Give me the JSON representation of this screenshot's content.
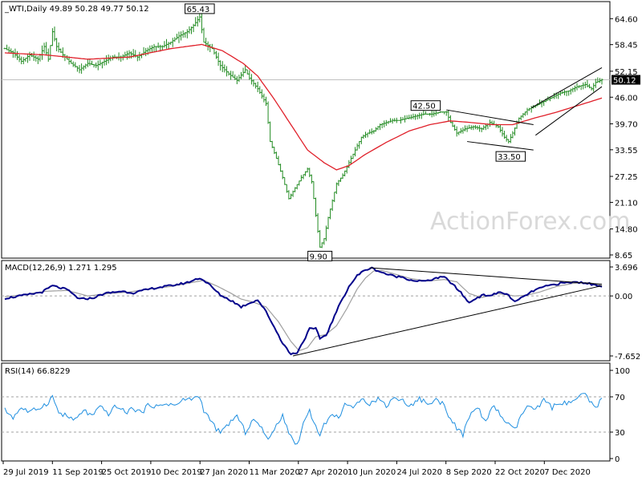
{
  "header": {
    "price_panel_label": "_WTI,Daily  49.89 50.28 49.77 50.12",
    "macd_panel_label": "MACD(12,26,9) 1.271 1.295",
    "rsi_panel_label": "RSI(14) 66.8229",
    "watermark": "ActionForex.com"
  },
  "chart_data": [
    {
      "type": "line",
      "panel": "price",
      "x_labels": [
        "29 Jul 2019",
        "11 Sep 2019",
        "25 Oct 2019",
        "10 Dec 2019",
        "27 Jan 2020",
        "11 Mar 2020",
        "27 Apr 2020",
        "10 Jun 2020",
        "24 Jul 2020",
        "8 Sep 2020",
        "22 Oct 2020",
        "7 Dec 2020"
      ],
      "y_ticks": [
        64.6,
        58.45,
        52.15,
        46.0,
        39.7,
        33.55,
        27.25,
        21.1,
        14.8,
        8.65
      ],
      "ylim": [
        8.65,
        67.5
      ],
      "last_price": 50.12,
      "last_price_label": "50.12",
      "price_anchors": [
        [
          0,
          57.5
        ],
        [
          4,
          56.5
        ],
        [
          8,
          54.5
        ],
        [
          12,
          56.0
        ],
        [
          16,
          55.0
        ],
        [
          19,
          58.0
        ],
        [
          21,
          55.0
        ],
        [
          23,
          61.5
        ],
        [
          25,
          58.0
        ],
        [
          28,
          56.0
        ],
        [
          32,
          54.0
        ],
        [
          36,
          52.5
        ],
        [
          40,
          54.0
        ],
        [
          44,
          53.5
        ],
        [
          48,
          54.5
        ],
        [
          52,
          55.5
        ],
        [
          56,
          55.5
        ],
        [
          60,
          56.5
        ],
        [
          64,
          55.5
        ],
        [
          68,
          57.0
        ],
        [
          72,
          58.0
        ],
        [
          76,
          58.0
        ],
        [
          80,
          59.0
        ],
        [
          84,
          60.5
        ],
        [
          88,
          61.5
        ],
        [
          91,
          63.0
        ],
        [
          94,
          65.0
        ],
        [
          96,
          59.0
        ],
        [
          100,
          57.5
        ],
        [
          104,
          53.5
        ],
        [
          108,
          51.5
        ],
        [
          112,
          50.0
        ],
        [
          116,
          52.5
        ],
        [
          118,
          50.5
        ],
        [
          122,
          48.0
        ],
        [
          126,
          44.5
        ],
        [
          128,
          35.5
        ],
        [
          131,
          31.5
        ],
        [
          134,
          27.0
        ],
        [
          137,
          22.0
        ],
        [
          140,
          24.5
        ],
        [
          143,
          27.0
        ],
        [
          146,
          29.0
        ],
        [
          148,
          26.0
        ],
        [
          150,
          18.0
        ],
        [
          152,
          10.5
        ],
        [
          154,
          12.5
        ],
        [
          156,
          17.5
        ],
        [
          158,
          21.5
        ],
        [
          160,
          25.5
        ],
        [
          163,
          27.5
        ],
        [
          166,
          30.5
        ],
        [
          169,
          33.5
        ],
        [
          172,
          36.5
        ],
        [
          175,
          37.5
        ],
        [
          178,
          38.0
        ],
        [
          181,
          39.5
        ],
        [
          184,
          40.0
        ],
        [
          187,
          40.5
        ],
        [
          190,
          40.5
        ],
        [
          194,
          41.0
        ],
        [
          198,
          41.5
        ],
        [
          202,
          42.0
        ],
        [
          206,
          42.0
        ],
        [
          210,
          42.5
        ],
        [
          213,
          42.5
        ],
        [
          215,
          40.0
        ],
        [
          218,
          37.5
        ],
        [
          222,
          38.5
        ],
        [
          226,
          39.0
        ],
        [
          230,
          38.5
        ],
        [
          234,
          40.0
        ],
        [
          238,
          39.0
        ],
        [
          241,
          36.5
        ],
        [
          243,
          35.5
        ],
        [
          245,
          37.5
        ],
        [
          248,
          41.0
        ],
        [
          252,
          43.0
        ],
        [
          256,
          44.0
        ],
        [
          260,
          45.0
        ],
        [
          264,
          46.0
        ],
        [
          268,
          47.0
        ],
        [
          272,
          47.5
        ],
        [
          276,
          48.5
        ],
        [
          280,
          49.0
        ],
        [
          283,
          48.0
        ],
        [
          285,
          49.5
        ],
        [
          288,
          50.12
        ]
      ],
      "ma55_anchors": [
        [
          0,
          56.5
        ],
        [
          20,
          56.0
        ],
        [
          40,
          55.0
        ],
        [
          60,
          55.5
        ],
        [
          80,
          57.5
        ],
        [
          95,
          58.5
        ],
        [
          105,
          57.0
        ],
        [
          115,
          54.0
        ],
        [
          122,
          51.0
        ],
        [
          130,
          45.5
        ],
        [
          138,
          39.5
        ],
        [
          146,
          33.5
        ],
        [
          154,
          30.5
        ],
        [
          160,
          28.8
        ],
        [
          166,
          29.8
        ],
        [
          174,
          32.5
        ],
        [
          184,
          35.3
        ],
        [
          195,
          38.0
        ],
        [
          205,
          39.5
        ],
        [
          215,
          40.4
        ],
        [
          225,
          40.0
        ],
        [
          235,
          39.5
        ],
        [
          245,
          39.5
        ],
        [
          255,
          41.0
        ],
        [
          265,
          42.3
        ],
        [
          275,
          43.8
        ],
        [
          288,
          45.8
        ]
      ],
      "annotations": [
        {
          "text": "65.43",
          "idx": 94,
          "value": 65.43,
          "pos": "above"
        },
        {
          "text": "9.90",
          "idx": 152,
          "value": 9.9,
          "pos": "below"
        },
        {
          "text": "42.50",
          "idx": 203,
          "value": 42.5,
          "pos": "above"
        },
        {
          "text": "33.50",
          "idx": 244,
          "value": 33.5,
          "pos": "below"
        }
      ],
      "trendlines": [
        [
          [
            213,
            43.0
          ],
          [
            255,
            39.5
          ]
        ],
        [
          [
            223,
            35.5
          ],
          [
            255,
            33.5
          ]
        ],
        [
          [
            254,
            43.5
          ],
          [
            288,
            53.0
          ]
        ],
        [
          [
            256,
            37.0
          ],
          [
            288,
            48.5
          ]
        ]
      ],
      "colors": {
        "bars": "#228b22",
        "ma": "#e0202a",
        "lastline": "#c0c0c0"
      }
    },
    {
      "type": "line",
      "panel": "macd",
      "y_ticks": [
        3.696,
        0.0,
        -7.652
      ],
      "y_tick_labels": [
        "3.696",
        "0.00",
        "-7.652"
      ],
      "ylim": [
        -7.652,
        3.696
      ],
      "macd_anchors": [
        [
          0,
          -0.3
        ],
        [
          10,
          0.1
        ],
        [
          18,
          0.5
        ],
        [
          23,
          1.3
        ],
        [
          30,
          0.8
        ],
        [
          36,
          -0.4
        ],
        [
          42,
          -0.3
        ],
        [
          48,
          0.3
        ],
        [
          56,
          0.6
        ],
        [
          62,
          0.4
        ],
        [
          72,
          1.0
        ],
        [
          80,
          1.3
        ],
        [
          88,
          1.7
        ],
        [
          94,
          2.3
        ],
        [
          98,
          1.6
        ],
        [
          104,
          0.1
        ],
        [
          110,
          -0.7
        ],
        [
          114,
          -1.4
        ],
        [
          118,
          -0.9
        ],
        [
          122,
          -0.5
        ],
        [
          126,
          -2.0
        ],
        [
          130,
          -4.0
        ],
        [
          134,
          -6.0
        ],
        [
          138,
          -7.45
        ],
        [
          141,
          -7.2
        ],
        [
          144,
          -5.8
        ],
        [
          147,
          -4.2
        ],
        [
          150,
          -4.2
        ],
        [
          152,
          -5.4
        ],
        [
          155,
          -5.0
        ],
        [
          158,
          -3.2
        ],
        [
          162,
          -0.8
        ],
        [
          166,
          1.2
        ],
        [
          170,
          2.6
        ],
        [
          174,
          3.35
        ],
        [
          177,
          3.55
        ],
        [
          180,
          3.2
        ],
        [
          184,
          2.8
        ],
        [
          188,
          2.5
        ],
        [
          192,
          2.4
        ],
        [
          196,
          2.0
        ],
        [
          200,
          1.9
        ],
        [
          204,
          1.9
        ],
        [
          208,
          2.3
        ],
        [
          212,
          2.4
        ],
        [
          216,
          1.5
        ],
        [
          220,
          0.4
        ],
        [
          224,
          -0.9
        ],
        [
          227,
          -0.3
        ],
        [
          231,
          0.1
        ],
        [
          235,
          0.1
        ],
        [
          239,
          0.5
        ],
        [
          243,
          0.1
        ],
        [
          246,
          -0.8
        ],
        [
          249,
          -0.3
        ],
        [
          252,
          0.2
        ],
        [
          256,
          0.8
        ],
        [
          262,
          1.3
        ],
        [
          268,
          1.6
        ],
        [
          274,
          1.75
        ],
        [
          280,
          1.7
        ],
        [
          284,
          1.4
        ],
        [
          288,
          1.271
        ]
      ],
      "signal_anchors": [
        [
          0,
          -0.1
        ],
        [
          10,
          0.2
        ],
        [
          20,
          0.6
        ],
        [
          30,
          0.7
        ],
        [
          40,
          0.0
        ],
        [
          50,
          0.3
        ],
        [
          60,
          0.5
        ],
        [
          70,
          0.9
        ],
        [
          80,
          1.2
        ],
        [
          90,
          1.7
        ],
        [
          96,
          2.0
        ],
        [
          102,
          1.3
        ],
        [
          108,
          0.5
        ],
        [
          114,
          -0.4
        ],
        [
          120,
          -0.8
        ],
        [
          126,
          -1.4
        ],
        [
          132,
          -3.3
        ],
        [
          138,
          -5.8
        ],
        [
          142,
          -7.0
        ],
        [
          146,
          -6.6
        ],
        [
          150,
          -5.2
        ],
        [
          155,
          -4.9
        ],
        [
          160,
          -3.8
        ],
        [
          165,
          -1.6
        ],
        [
          170,
          0.9
        ],
        [
          174,
          2.3
        ],
        [
          178,
          3.2
        ],
        [
          182,
          3.25
        ],
        [
          188,
          2.8
        ],
        [
          196,
          2.2
        ],
        [
          204,
          1.9
        ],
        [
          212,
          2.1
        ],
        [
          218,
          1.8
        ],
        [
          224,
          0.3
        ],
        [
          230,
          -0.2
        ],
        [
          238,
          0.3
        ],
        [
          246,
          0.0
        ],
        [
          252,
          0.1
        ],
        [
          258,
          0.5
        ],
        [
          266,
          1.2
        ],
        [
          274,
          1.6
        ],
        [
          282,
          1.7
        ],
        [
          288,
          1.295
        ]
      ],
      "trendlines": [
        [
          [
            139,
            -7.65
          ],
          [
            288,
            1.3
          ]
        ],
        [
          [
            176,
            3.6
          ],
          [
            288,
            1.5
          ]
        ]
      ],
      "colors": {
        "macd": "#00008b",
        "signal": "#a0a0a0"
      }
    },
    {
      "type": "line",
      "panel": "rsi",
      "y_ticks": [
        100,
        70,
        30,
        0
      ],
      "y_tick_labels": [
        "100",
        "70",
        "30",
        "0"
      ],
      "ylim": [
        0,
        100
      ],
      "last_value": 66.8229,
      "rsi_anchors": [
        [
          0,
          55
        ],
        [
          4,
          47
        ],
        [
          8,
          58
        ],
        [
          12,
          52
        ],
        [
          16,
          57
        ],
        [
          20,
          62
        ],
        [
          23,
          70
        ],
        [
          26,
          52
        ],
        [
          30,
          48
        ],
        [
          34,
          43
        ],
        [
          38,
          55
        ],
        [
          42,
          48
        ],
        [
          46,
          58
        ],
        [
          50,
          51
        ],
        [
          54,
          60
        ],
        [
          58,
          52
        ],
        [
          62,
          57
        ],
        [
          66,
          52
        ],
        [
          70,
          62
        ],
        [
          74,
          58
        ],
        [
          78,
          63
        ],
        [
          82,
          60
        ],
        [
          86,
          66
        ],
        [
          90,
          68
        ],
        [
          94,
          70
        ],
        [
          96,
          55
        ],
        [
          100,
          40
        ],
        [
          104,
          28
        ],
        [
          108,
          40
        ],
        [
          112,
          48
        ],
        [
          116,
          30
        ],
        [
          120,
          45
        ],
        [
          124,
          33
        ],
        [
          128,
          22
        ],
        [
          131,
          38
        ],
        [
          134,
          50
        ],
        [
          138,
          24
        ],
        [
          141,
          15
        ],
        [
          144,
          40
        ],
        [
          147,
          55
        ],
        [
          150,
          36
        ],
        [
          152,
          28
        ],
        [
          155,
          42
        ],
        [
          158,
          50
        ],
        [
          161,
          46
        ],
        [
          164,
          63
        ],
        [
          168,
          55
        ],
        [
          172,
          70
        ],
        [
          176,
          62
        ],
        [
          180,
          68
        ],
        [
          184,
          60
        ],
        [
          188,
          70
        ],
        [
          192,
          65
        ],
        [
          196,
          60
        ],
        [
          200,
          68
        ],
        [
          204,
          62
        ],
        [
          208,
          66
        ],
        [
          212,
          62
        ],
        [
          215,
          44
        ],
        [
          218,
          35
        ],
        [
          221,
          26
        ],
        [
          224,
          48
        ],
        [
          228,
          58
        ],
        [
          232,
          42
        ],
        [
          236,
          60
        ],
        [
          240,
          46
        ],
        [
          243,
          38
        ],
        [
          246,
          32
        ],
        [
          249,
          48
        ],
        [
          252,
          60
        ],
        [
          256,
          54
        ],
        [
          260,
          66
        ],
        [
          264,
          58
        ],
        [
          268,
          64
        ],
        [
          272,
          62
        ],
        [
          276,
          68
        ],
        [
          280,
          73
        ],
        [
          282,
          64
        ],
        [
          285,
          58
        ],
        [
          288,
          66.8
        ]
      ],
      "colors": {
        "rsi": "#1f8fe0",
        "levels": "#a0a0a0"
      }
    }
  ]
}
